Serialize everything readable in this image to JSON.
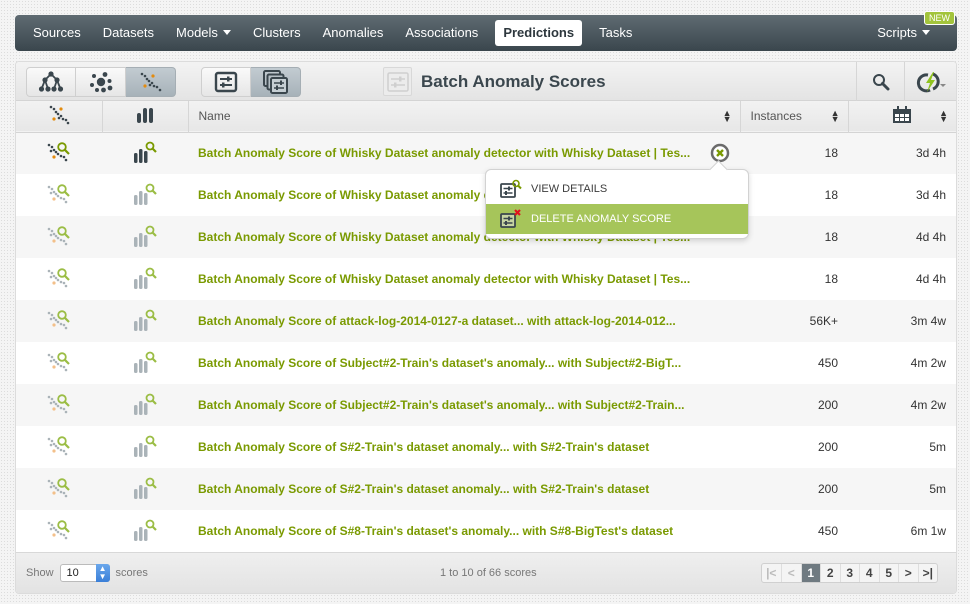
{
  "nav": {
    "items": [
      {
        "label": "Sources"
      },
      {
        "label": "Datasets"
      },
      {
        "label": "Models",
        "dropdown": true
      },
      {
        "label": "Clusters"
      },
      {
        "label": "Anomalies"
      },
      {
        "label": "Associations"
      },
      {
        "label": "Predictions",
        "active": true
      },
      {
        "label": "Tasks"
      }
    ],
    "scripts": {
      "label": "Scripts",
      "badge": "NEW"
    }
  },
  "toolbar": {
    "view_buttons": [
      {
        "icon": "model-tree-icon",
        "active": false
      },
      {
        "icon": "cluster-icon",
        "active": false
      },
      {
        "icon": "anomaly-icon",
        "active": true
      }
    ],
    "mode_buttons": [
      {
        "icon": "single-prediction-icon",
        "active": false
      },
      {
        "icon": "batch-prediction-icon",
        "active": true
      }
    ],
    "title": "Batch Anomaly Scores",
    "search_icon": "search-icon",
    "bigml_icon": "whizzml-icon"
  },
  "table": {
    "columns": [
      {
        "icon": "anomaly-icon"
      },
      {
        "icon": "bar-chart-icon"
      },
      {
        "label": "Name"
      },
      {
        "label": "Instances"
      },
      {
        "icon": "calendar-icon"
      }
    ],
    "rows": [
      {
        "name": "Batch Anomaly Score of Whisky Dataset anomaly detector with Whisky Dataset | Tes...",
        "instances": "18",
        "age": "3d 4h",
        "hovered": true
      },
      {
        "name": "Batch Anomaly Score of Whisky Dataset anomaly detector with Whisky Dataset | Tes...",
        "instances": "18",
        "age": "3d 4h"
      },
      {
        "name": "Batch Anomaly Score of Whisky Dataset anomaly detector with Whisky Dataset | Tes...",
        "instances": "18",
        "age": "4d 4h"
      },
      {
        "name": "Batch Anomaly Score of Whisky Dataset anomaly detector with Whisky Dataset | Tes...",
        "instances": "18",
        "age": "4d 4h"
      },
      {
        "name": "Batch Anomaly Score of attack-log-2014-0127-a dataset... with attack-log-2014-012...",
        "instances": "56K+",
        "age": "3m 4w"
      },
      {
        "name": "Batch Anomaly Score of Subject#2-Train's dataset's anomaly... with Subject#2-BigT...",
        "instances": "450",
        "age": "4m 2w"
      },
      {
        "name": "Batch Anomaly Score of Subject#2-Train's dataset's anomaly... with Subject#2-Train...",
        "instances": "200",
        "age": "4m 2w"
      },
      {
        "name": "Batch Anomaly Score of S#2-Train's dataset anomaly... with S#2-Train's dataset",
        "instances": "200",
        "age": "5m"
      },
      {
        "name": "Batch Anomaly Score of S#2-Train's dataset anomaly... with S#2-Train's dataset",
        "instances": "200",
        "age": "5m"
      },
      {
        "name": "Batch Anomaly Score of S#8-Train's dataset's anomaly... with S#8-BigTest's dataset",
        "instances": "450",
        "age": "6m 1w"
      }
    ]
  },
  "popup": {
    "items": [
      {
        "label": "VIEW DETAILS",
        "icon": "view-details-icon"
      },
      {
        "label": "DELETE ANOMALY SCORE",
        "icon": "delete-icon",
        "highlighted": true
      }
    ]
  },
  "footer": {
    "show_label": "Show",
    "page_size": "10",
    "unit_label": "scores",
    "range_text": "1 to 10 of 66 scores",
    "pages": [
      "1",
      "2",
      "3",
      "4",
      "5"
    ],
    "current_page": "1"
  },
  "colors": {
    "accent_green": "#7a9a01",
    "menu_highlight": "#a6c55a",
    "nav_dark": "#3a464d",
    "anomaly_orange": "#e38b0e"
  }
}
